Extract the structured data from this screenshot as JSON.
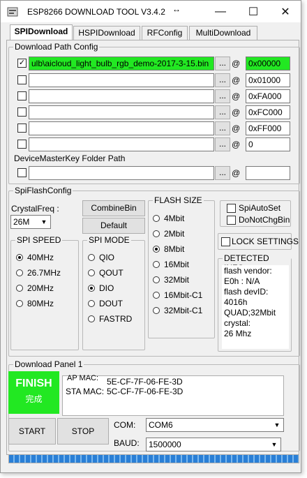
{
  "window": {
    "title": "ESP8266 DOWNLOAD TOOL V3.4.2",
    "resize_glyph": "↔",
    "minimize": "—",
    "maximize": "☐",
    "close": "✕"
  },
  "tabs": [
    "SPIDownload",
    "HSPIDownload",
    "RFConfig",
    "MultiDownload"
  ],
  "download_path": {
    "group_label": "Download Path Config",
    "rows": [
      {
        "checked": true,
        "path": "ulb\\aicloud_light_bulb_rgb_demo-2017-3-15.bin",
        "address": "0x00000",
        "browse": "...",
        "at": "@"
      },
      {
        "checked": false,
        "path": "",
        "address": "0x01000",
        "browse": "...",
        "at": "@"
      },
      {
        "checked": false,
        "path": "",
        "address": "0xFA000",
        "browse": "...",
        "at": "@"
      },
      {
        "checked": false,
        "path": "",
        "address": "0xFC000",
        "browse": "...",
        "at": "@"
      },
      {
        "checked": false,
        "path": "",
        "address": "0xFF000",
        "browse": "...",
        "at": "@"
      },
      {
        "checked": false,
        "path": "",
        "address": "0",
        "browse": "...",
        "at": "@"
      }
    ],
    "master_key_label": "DeviceMasterKey Folder Path",
    "master_key_path": "",
    "master_key_address": "",
    "master_key_browse": "...",
    "master_key_at": "@"
  },
  "spi_flash": {
    "group_label": "SpiFlashConfig",
    "crystal_label": "CrystalFreq :",
    "crystal_value": "26M",
    "combine_button": "CombineBin",
    "default_button": "Default",
    "spi_speed": {
      "label": "SPI SPEED",
      "options": [
        "40MHz",
        "26.7MHz",
        "20MHz",
        "80MHz"
      ],
      "selected": "40MHz"
    },
    "spi_mode": {
      "label": "SPI MODE",
      "options": [
        "QIO",
        "QOUT",
        "DIO",
        "DOUT",
        "FASTRD"
      ],
      "selected": "DIO"
    },
    "flash_size": {
      "label": "FLASH SIZE",
      "options": [
        "4Mbit",
        "2Mbit",
        "8Mbit",
        "16Mbit",
        "32Mbit",
        "16Mbit-C1",
        "32Mbit-C1"
      ],
      "selected": "8Mbit"
    },
    "spi_auto_set": "SpiAutoSet",
    "do_not_chg_bin": "DoNotChgBin",
    "lock_settings": "LOCK SETTINGS",
    "detected_info": {
      "label": "DETECTED INFO",
      "lines": [
        "flash vendor:",
        "E0h : N/A",
        "flash devID:",
        "4016h",
        "QUAD;32Mbit",
        "crystal:",
        "26 Mhz"
      ]
    }
  },
  "download_panel": {
    "label": "Download Panel 1",
    "status": "FINISH",
    "status_sub": "完成",
    "ap_mac_label": "AP MAC:",
    "ap_mac_value": "5E-CF-7F-06-FE-3D",
    "sta_mac_label": "STA MAC:",
    "sta_mac_value": "5C-CF-7F-06-FE-3D",
    "start_button": "START",
    "stop_button": "STOP",
    "com_label": "COM:",
    "com_value": "COM6",
    "baud_label": "BAUD:",
    "baud_value": "1500000",
    "progress": 1.0
  },
  "colors": {
    "success_green": "#22e822",
    "progress_blue": "#2a7fd6"
  }
}
